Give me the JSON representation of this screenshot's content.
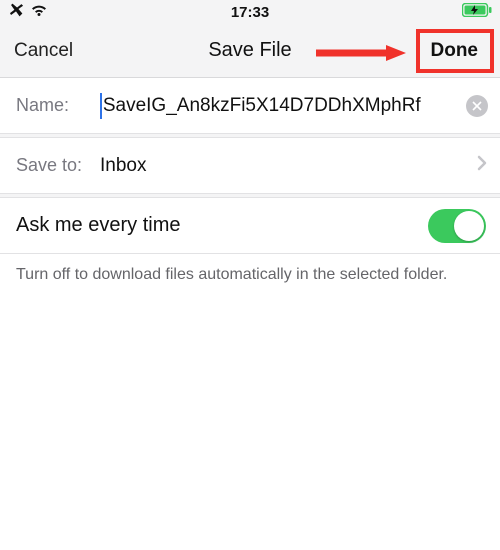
{
  "status": {
    "time": "17:33"
  },
  "header": {
    "cancel": "Cancel",
    "title": "Save File",
    "done": "Done"
  },
  "name": {
    "label": "Name:",
    "value": "SaveIG_An8kzFi5X14D7DDhXMphRf"
  },
  "saveto": {
    "label": "Save to:",
    "value": "Inbox"
  },
  "toggle": {
    "label": "Ask me every time",
    "on": true
  },
  "footer": "Turn off to download files automatically in the selected folder."
}
